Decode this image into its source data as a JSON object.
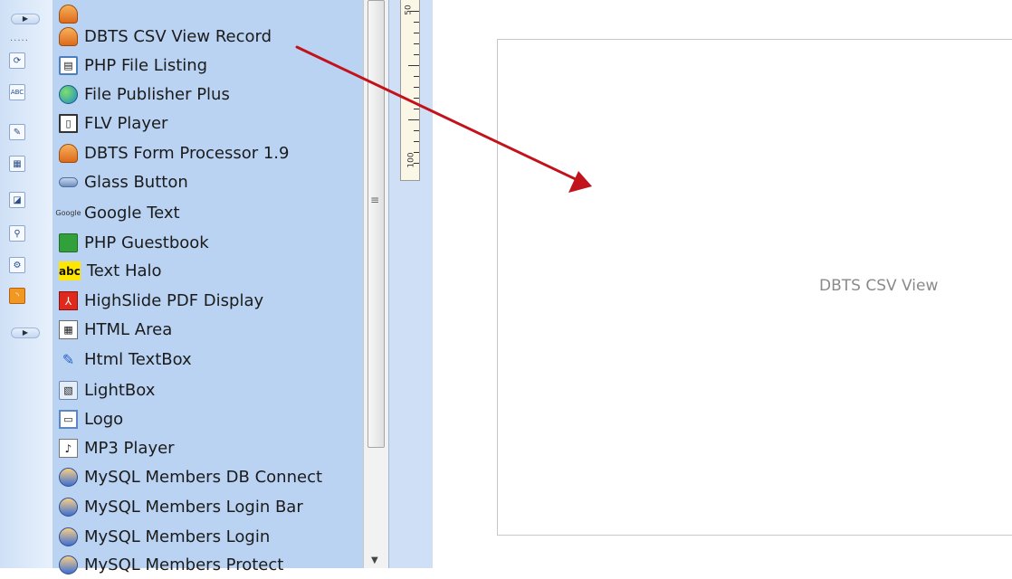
{
  "panel_items": [
    {
      "label": "DBTS CSV View Record",
      "icon": "dbts-icon"
    },
    {
      "label": "PHP File Listing",
      "icon": "folder-icon"
    },
    {
      "label": "File Publisher Plus",
      "icon": "globe-icon"
    },
    {
      "label": "FLV Player",
      "icon": "film-icon"
    },
    {
      "label": "DBTS Form Processor 1.9",
      "icon": "dbts-icon"
    },
    {
      "label": "Glass Button",
      "icon": "glass-button-icon"
    },
    {
      "label": "Google Text",
      "icon": "google-icon"
    },
    {
      "label": "PHP Guestbook",
      "icon": "guestbook-icon"
    },
    {
      "label": "Text Halo",
      "icon": "abc-icon"
    },
    {
      "label": "HighSlide PDF Display",
      "icon": "pdf-icon"
    },
    {
      "label": "HTML Area",
      "icon": "html-area-icon"
    },
    {
      "label": "Html TextBox",
      "icon": "pen-icon"
    },
    {
      "label": "LightBox",
      "icon": "lightbox-icon"
    },
    {
      "label": "Logo",
      "icon": "logo-icon"
    },
    {
      "label": "MP3 Player",
      "icon": "mp3-icon"
    },
    {
      "label": "MySQL Members DB Connect",
      "icon": "user-icon"
    },
    {
      "label": "MySQL Members Login Bar",
      "icon": "user-icon"
    },
    {
      "label": "MySQL Members Login",
      "icon": "user-icon"
    },
    {
      "label": "MySQL Members Protect",
      "icon": "user-icon"
    }
  ],
  "canvas": {
    "label": "DBTS CSV View"
  },
  "ruler": {
    "top_label": "50",
    "bottom_label": "100"
  },
  "colors": {
    "panel_bg": "#bad3f3",
    "arrow": "#c2121b"
  }
}
